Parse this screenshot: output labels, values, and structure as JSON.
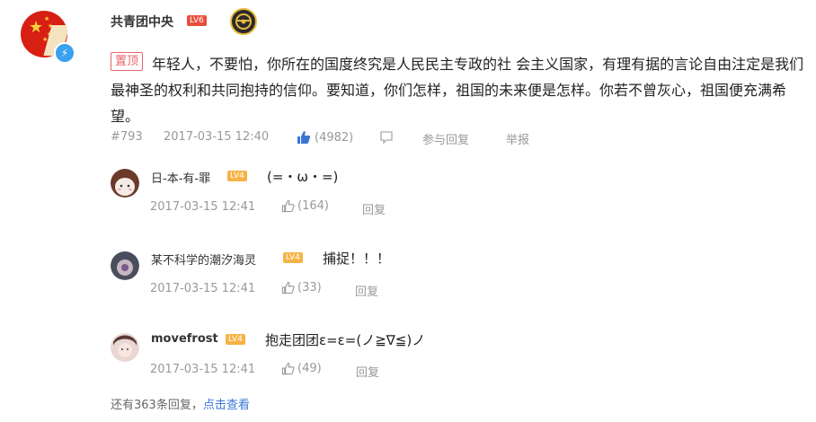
{
  "post": {
    "username": "共青团中央",
    "level": "LV6",
    "pin_tag": "置顶",
    "content": "年轻人，不要怕，你所在的国度终究是人民民主专政的社 会主义国家，有理有据的言论自由注定是我们最神圣的权利和共同抱持的信仰。要知道，你们怎样，祖国的未来便是怎样。你若不曾灰心，祖国便充满希望。",
    "floor": "#793",
    "time": "2017-03-15 12:40",
    "likes": "(4982)",
    "reply_label": "参与回复",
    "report_label": "举报",
    "like_color": "#3b76d6"
  },
  "replies": [
    {
      "username": "日-本-有-罪",
      "text": "(=・ω・=)",
      "time": "2017-03-15 12:41",
      "likes": "(164)",
      "reply_label": "回复"
    },
    {
      "username": "某不科学的潮汐海灵",
      "text": "捕捉！！！",
      "time": "2017-03-15 12:41",
      "likes": "(33)",
      "reply_label": "回复"
    },
    {
      "username": "movefrost",
      "text": "抱走团团ε=ε=(ノ≧∇≦)ノ",
      "time": "2017-03-15 12:41",
      "likes": "(49)",
      "reply_label": "回复"
    }
  ],
  "more": {
    "prefix": "还有363条回复，",
    "link": "点击查看"
  }
}
